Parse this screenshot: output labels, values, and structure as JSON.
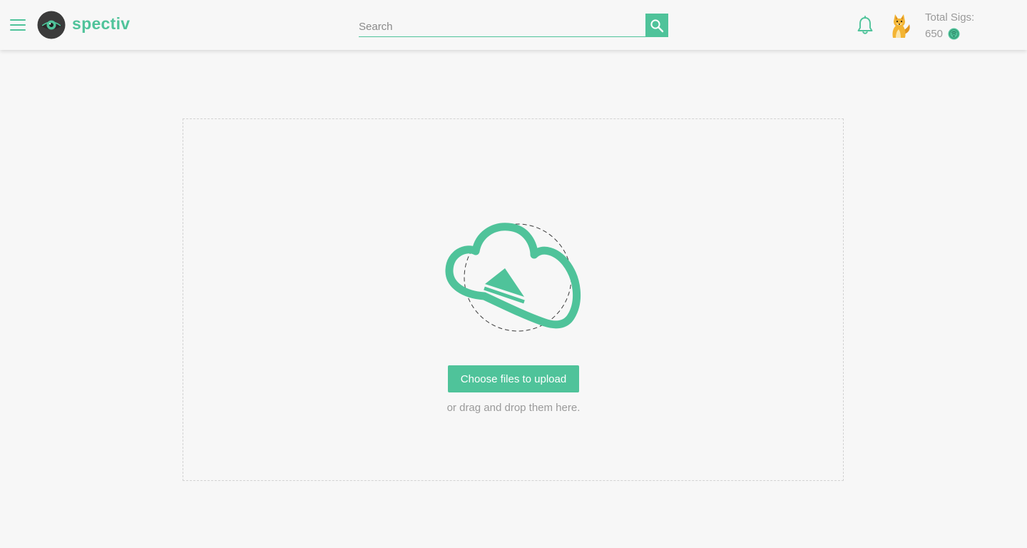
{
  "header": {
    "menu_icon": "hamburger-menu-icon",
    "logo_icon": "eye-logo-icon",
    "logo_text": "spectiv",
    "search": {
      "placeholder": "Search",
      "value": "",
      "button_icon": "search-icon"
    },
    "notifications_icon": "bell-icon",
    "avatar_icon": "fox-avatar",
    "total_sigs_label": "Total Sigs:",
    "total_sigs_value": "650",
    "sigs_currency_icon": "sig-coin-icon"
  },
  "upload": {
    "icon": "cloud-upload-icon",
    "button_label": "Choose files to upload",
    "hint": "or drag and drop them here."
  },
  "colors": {
    "accent": "#4fc39a",
    "background": "#f7f7f7",
    "muted_text": "#9a9a9a",
    "logo_dark": "#3b3b3b"
  }
}
